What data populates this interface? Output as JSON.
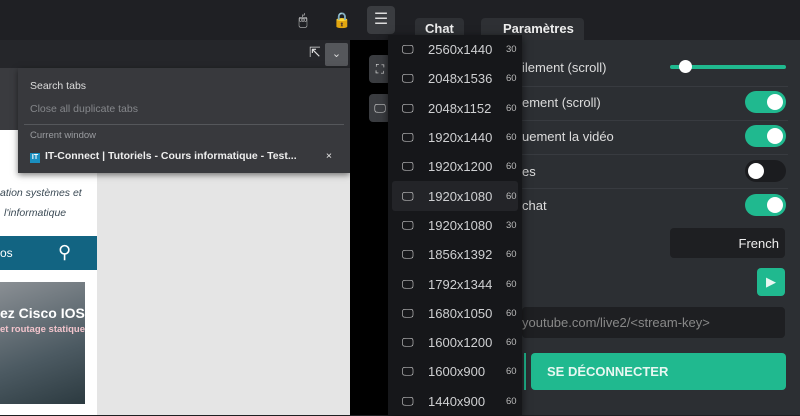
{
  "toolbar": {
    "mouse_icon": "mouse-icon",
    "lock_icon": "lock-icon",
    "menu_icon": "hamburger-icon"
  },
  "panel_tabs": [
    {
      "label": "Chat"
    },
    {
      "label": "Paramètres"
    }
  ],
  "tab_search": {
    "search_label": "Search tabs",
    "close_duplicates": "Close all duplicate tabs",
    "section": "Current window",
    "tab_favicon": "IT",
    "tab_title": "IT-Connect | Tutoriels - Cours informatique - Test...",
    "close": "×"
  },
  "webpage": {
    "tagline1": "ation systèmes et",
    "tagline2": "l'informatique",
    "search_text": "os",
    "banner_title": "ez Cisco IOS",
    "banner_sub": "et routage statique"
  },
  "resolutions": [
    {
      "res": "2560x1440",
      "hz": "30"
    },
    {
      "res": "2048x1536",
      "hz": "60"
    },
    {
      "res": "2048x1152",
      "hz": "60"
    },
    {
      "res": "1920x1440",
      "hz": "60"
    },
    {
      "res": "1920x1200",
      "hz": "60"
    },
    {
      "res": "1920x1080",
      "hz": "60",
      "selected": true
    },
    {
      "res": "1920x1080",
      "hz": "30"
    },
    {
      "res": "1856x1392",
      "hz": "60"
    },
    {
      "res": "1792x1344",
      "hz": "60"
    },
    {
      "res": "1680x1050",
      "hz": "60"
    },
    {
      "res": "1600x1200",
      "hz": "60"
    },
    {
      "res": "1600x900",
      "hz": "60"
    },
    {
      "res": "1440x900",
      "hz": "60"
    }
  ],
  "settings": {
    "row1": "ilement (scroll)",
    "slider_value": 0.1,
    "row2": "ement (scroll)",
    "row2_on": true,
    "row3": "uement la vidéo",
    "row3_on": true,
    "row4": "es",
    "row4_on": false,
    "row5": "chat",
    "row5_on": true,
    "language": "French",
    "stream_url": "youtube.com/live2/<stream-key>",
    "disconnect": "SE DÉCONNECTER"
  },
  "colors": {
    "accent": "#20b98f",
    "panel": "#2c2f33"
  }
}
